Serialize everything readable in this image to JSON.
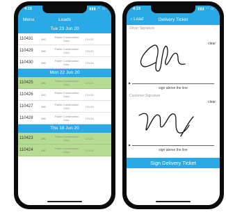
{
  "loads_screen": {
    "time": "4:16",
    "menu_label": "Menu",
    "title": "Loads",
    "sections": [
      {
        "header": "Tue 23 Jun 20",
        "rows": [
          {
            "id": "110431",
            "qty": "100",
            "customer": "Fisher Construction Corp.",
            "code": "CH-31",
            "highlight": false
          },
          {
            "id": "110429",
            "qty": "100",
            "customer": "Fisher Construction Corp.",
            "code": "CH-31",
            "highlight": false
          },
          {
            "id": "110430",
            "qty": "100",
            "customer": "Fisher Construction Corp.",
            "code": "CH-31",
            "highlight": false
          }
        ]
      },
      {
        "header": "Mon 22 Jun 20",
        "rows": [
          {
            "id": "110425",
            "qty": "100",
            "customer": "Fisher Construction Corp.",
            "code": "CH-21",
            "highlight": true
          },
          {
            "id": "110426",
            "qty": "100",
            "customer": "Fisher Construction Corp.",
            "code": "CH-32",
            "highlight": false
          },
          {
            "id": "110427",
            "qty": "100",
            "customer": "Fisher Construction Corp.",
            "code": "CH-26",
            "highlight": false
          },
          {
            "id": "110428",
            "qty": "100",
            "customer": "Fisher Construction Corp.",
            "code": "CH-31",
            "highlight": false
          }
        ]
      },
      {
        "header": "Thu 18 Jun 20",
        "rows": [
          {
            "id": "110423",
            "qty": "100",
            "customer": "Fisher Construction Corp.",
            "code": "CH-31",
            "highlight": true
          },
          {
            "id": "110424",
            "qty": "100",
            "customer": "Fisher Construction Corp.",
            "code": "CH-31",
            "highlight": true
          }
        ]
      }
    ]
  },
  "ticket_screen": {
    "time": "4:19",
    "back_label": "Load",
    "title": "Delivery Ticket",
    "driver_label": "Driver Signature",
    "customer_label": "Customer Signature",
    "clear_label": "clear",
    "sign_hint": "sign above the line",
    "sign_button": "Sign Delivery Ticket"
  },
  "colors": {
    "accent": "#29a9e6",
    "highlight_row": "#b6dc93"
  }
}
